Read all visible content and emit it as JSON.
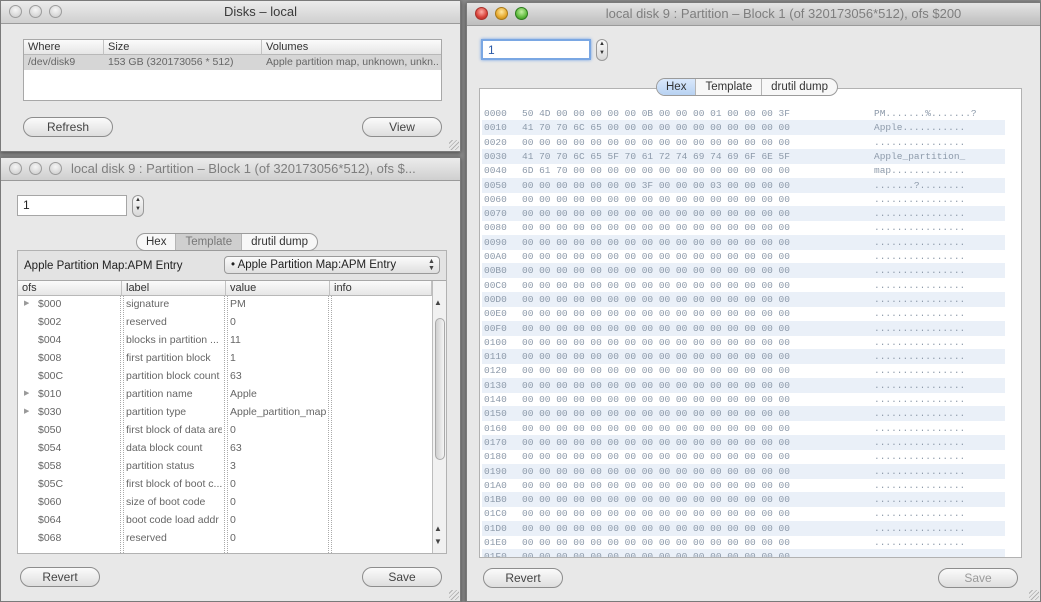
{
  "disks_window": {
    "title": "Disks – local",
    "columns": [
      "Where",
      "Size",
      "Volumes"
    ],
    "rows": [
      {
        "where": "/dev/disk9",
        "size": "153 GB (320173056 * 512)",
        "volumes": "Apple partition map, unknown, unkn..."
      }
    ],
    "refresh_label": "Refresh",
    "view_label": "View"
  },
  "template_window": {
    "title": "local disk 9 : Partition – Block 1 (of 320173056*512), ofs $...",
    "block_value": "1",
    "tabs": [
      "Hex",
      "Template",
      "drutil dump"
    ],
    "template_label": "Apple Partition Map:APM Entry",
    "template_popup": "• Apple Partition Map:APM Entry",
    "columns": [
      "ofs",
      "label",
      "value",
      "info"
    ],
    "rows": [
      {
        "ofs": "$000",
        "label": "signature",
        "value": "PM",
        "expand": true
      },
      {
        "ofs": "$002",
        "label": "reserved",
        "value": "0",
        "expand": false
      },
      {
        "ofs": "$004",
        "label": "blocks in partition ...",
        "value": "11",
        "expand": false
      },
      {
        "ofs": "$008",
        "label": "first partition block",
        "value": "1",
        "expand": false
      },
      {
        "ofs": "$00C",
        "label": "partition block count",
        "value": "63",
        "expand": false
      },
      {
        "ofs": "$010",
        "label": "partition name",
        "value": "Apple",
        "expand": true
      },
      {
        "ofs": "$030",
        "label": "partition type",
        "value": "Apple_partition_map",
        "expand": true
      },
      {
        "ofs": "$050",
        "label": "first block of data area",
        "value": "0",
        "expand": false
      },
      {
        "ofs": "$054",
        "label": "data block count",
        "value": "63",
        "expand": false
      },
      {
        "ofs": "$058",
        "label": "partition status",
        "value": "3",
        "expand": false
      },
      {
        "ofs": "$05C",
        "label": "first block of boot c...",
        "value": "0",
        "expand": false
      },
      {
        "ofs": "$060",
        "label": "size of boot code",
        "value": "0",
        "expand": false
      },
      {
        "ofs": "$064",
        "label": "boot code load addr",
        "value": "0",
        "expand": false
      },
      {
        "ofs": "$068",
        "label": "reserved",
        "value": "0",
        "expand": false
      }
    ],
    "revert_label": "Revert",
    "save_label": "Save"
  },
  "hex_window": {
    "title": "local disk 9 : Partition – Block 1 (of 320173056*512), ofs $200",
    "block_value": "1",
    "tabs": [
      "Hex",
      "Template",
      "drutil dump"
    ],
    "rows": [
      {
        "addr": "0000",
        "bytes": "50 4D 00 00 00 00 00 0B 00 00 00 01 00 00 00 3F",
        "ascii": "PM.......%.......?"
      },
      {
        "addr": "0010",
        "bytes": "41 70 70 6C 65 00 00 00 00 00 00 00 00 00 00 00",
        "ascii": "Apple..........."
      },
      {
        "addr": "0020",
        "bytes": "00 00 00 00 00 00 00 00 00 00 00 00 00 00 00 00",
        "ascii": "................"
      },
      {
        "addr": "0030",
        "bytes": "41 70 70 6C 65 5F 70 61 72 74 69 74 69 6F 6E 5F",
        "ascii": "Apple_partition_"
      },
      {
        "addr": "0040",
        "bytes": "6D 61 70 00 00 00 00 00 00 00 00 00 00 00 00 00",
        "ascii": "map............."
      },
      {
        "addr": "0050",
        "bytes": "00 00 00 00 00 00 00 3F 00 00 00 03 00 00 00 00",
        "ascii": ".......?........"
      },
      {
        "addr": "0060",
        "bytes": "00 00 00 00 00 00 00 00 00 00 00 00 00 00 00 00",
        "ascii": "................"
      },
      {
        "addr": "0070",
        "bytes": "00 00 00 00 00 00 00 00 00 00 00 00 00 00 00 00",
        "ascii": "................"
      },
      {
        "addr": "0080",
        "bytes": "00 00 00 00 00 00 00 00 00 00 00 00 00 00 00 00",
        "ascii": "................"
      },
      {
        "addr": "0090",
        "bytes": "00 00 00 00 00 00 00 00 00 00 00 00 00 00 00 00",
        "ascii": "................"
      },
      {
        "addr": "00A0",
        "bytes": "00 00 00 00 00 00 00 00 00 00 00 00 00 00 00 00",
        "ascii": "................"
      },
      {
        "addr": "00B0",
        "bytes": "00 00 00 00 00 00 00 00 00 00 00 00 00 00 00 00",
        "ascii": "................"
      },
      {
        "addr": "00C0",
        "bytes": "00 00 00 00 00 00 00 00 00 00 00 00 00 00 00 00",
        "ascii": "................"
      },
      {
        "addr": "00D0",
        "bytes": "00 00 00 00 00 00 00 00 00 00 00 00 00 00 00 00",
        "ascii": "................"
      },
      {
        "addr": "00E0",
        "bytes": "00 00 00 00 00 00 00 00 00 00 00 00 00 00 00 00",
        "ascii": "................"
      },
      {
        "addr": "00F0",
        "bytes": "00 00 00 00 00 00 00 00 00 00 00 00 00 00 00 00",
        "ascii": "................"
      },
      {
        "addr": "0100",
        "bytes": "00 00 00 00 00 00 00 00 00 00 00 00 00 00 00 00",
        "ascii": "................"
      },
      {
        "addr": "0110",
        "bytes": "00 00 00 00 00 00 00 00 00 00 00 00 00 00 00 00",
        "ascii": "................"
      },
      {
        "addr": "0120",
        "bytes": "00 00 00 00 00 00 00 00 00 00 00 00 00 00 00 00",
        "ascii": "................"
      },
      {
        "addr": "0130",
        "bytes": "00 00 00 00 00 00 00 00 00 00 00 00 00 00 00 00",
        "ascii": "................"
      },
      {
        "addr": "0140",
        "bytes": "00 00 00 00 00 00 00 00 00 00 00 00 00 00 00 00",
        "ascii": "................"
      },
      {
        "addr": "0150",
        "bytes": "00 00 00 00 00 00 00 00 00 00 00 00 00 00 00 00",
        "ascii": "................"
      },
      {
        "addr": "0160",
        "bytes": "00 00 00 00 00 00 00 00 00 00 00 00 00 00 00 00",
        "ascii": "................"
      },
      {
        "addr": "0170",
        "bytes": "00 00 00 00 00 00 00 00 00 00 00 00 00 00 00 00",
        "ascii": "................"
      },
      {
        "addr": "0180",
        "bytes": "00 00 00 00 00 00 00 00 00 00 00 00 00 00 00 00",
        "ascii": "................"
      },
      {
        "addr": "0190",
        "bytes": "00 00 00 00 00 00 00 00 00 00 00 00 00 00 00 00",
        "ascii": "................"
      },
      {
        "addr": "01A0",
        "bytes": "00 00 00 00 00 00 00 00 00 00 00 00 00 00 00 00",
        "ascii": "................"
      },
      {
        "addr": "01B0",
        "bytes": "00 00 00 00 00 00 00 00 00 00 00 00 00 00 00 00",
        "ascii": "................"
      },
      {
        "addr": "01C0",
        "bytes": "00 00 00 00 00 00 00 00 00 00 00 00 00 00 00 00",
        "ascii": "................"
      },
      {
        "addr": "01D0",
        "bytes": "00 00 00 00 00 00 00 00 00 00 00 00 00 00 00 00",
        "ascii": "................"
      },
      {
        "addr": "01E0",
        "bytes": "00 00 00 00 00 00 00 00 00 00 00 00 00 00 00 00",
        "ascii": "................"
      },
      {
        "addr": "01F0",
        "bytes": "00 00 00 00 00 00 00 00 00 00 00 00 00 00 00 00",
        "ascii": "................"
      }
    ],
    "revert_label": "Revert",
    "save_label": "Save"
  },
  "colors": {
    "selected_tab": "#b8d2f2",
    "hex_alt_row": "#eaf0f8",
    "hex_text": "#8d9aaa"
  }
}
